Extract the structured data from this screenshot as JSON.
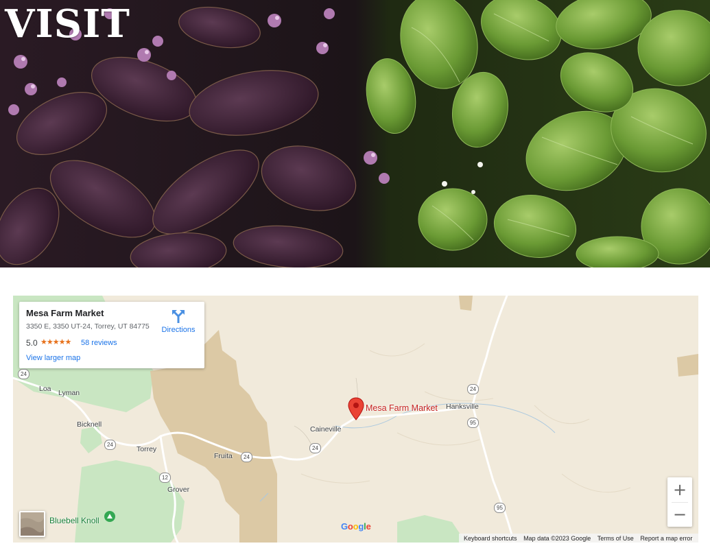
{
  "hero": {
    "title": "VISIT"
  },
  "map": {
    "info_card": {
      "place_name": "Mesa Farm Market",
      "address": "3350 E, 3350 UT-24, Torrey, UT 84775",
      "rating": "5.0",
      "stars": "★★★★★",
      "reviews_label": "58 reviews",
      "larger_map_label": "View larger map",
      "directions_label": "Directions",
      "directions_icon": "directions-icon"
    },
    "marker_label": "Mesa Farm Market",
    "places": {
      "loa": "Loa",
      "lyman": "Lyman",
      "bicknell": "Bicknell",
      "torrey": "Torrey",
      "fruita": "Fruita",
      "grover": "Grover",
      "caineville": "Caineville",
      "hanksville": "Hanksville"
    },
    "routes": {
      "r24_west": "24",
      "r24_bicknell": "24",
      "r24_fruita": "24",
      "r24_caineville": "24",
      "r24_hanksville": "24",
      "r12": "12",
      "r95_north": "95",
      "r95_south": "95"
    },
    "poi_label": "Bluebell Knoll",
    "zoom_in_label": "+",
    "zoom_out_label": "−",
    "google_letters": [
      "G",
      "o",
      "o",
      "g",
      "l",
      "e"
    ],
    "google_colors": [
      "#4285F4",
      "#EA4335",
      "#FBBC05",
      "#4285F4",
      "#34A853",
      "#EA4335"
    ],
    "attribution": {
      "keyboard_shortcuts": "Keyboard shortcuts",
      "map_data": "Map data ©2023 Google",
      "terms": "Terms of Use",
      "report": "Report a map error"
    },
    "colors": {
      "land": "#f1eadb",
      "park": "#c9e6c2",
      "desert": "#dcc9a5",
      "road": "#ffffff",
      "link": "#1a73e8",
      "marker": "#ea4335"
    }
  }
}
